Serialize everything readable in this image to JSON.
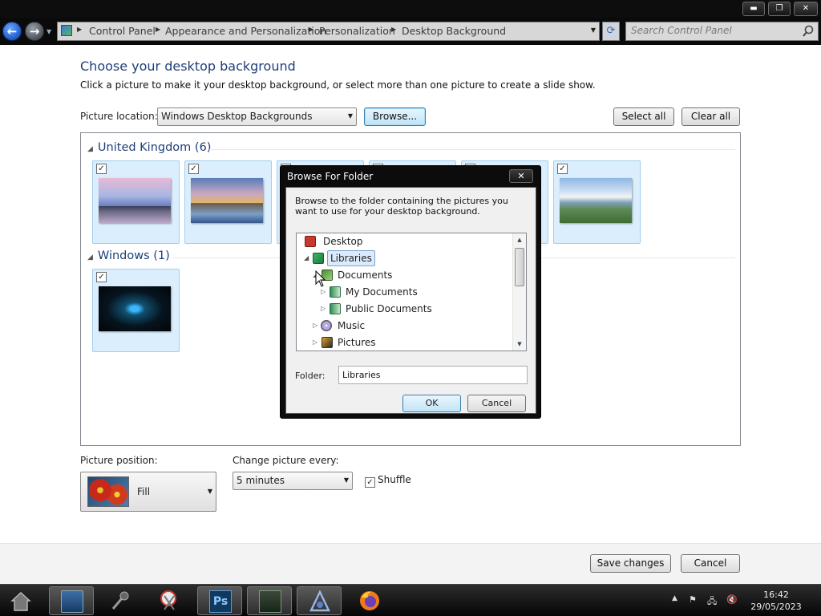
{
  "breadcrumbs": [
    "Control Panel",
    "Appearance and Personalization",
    "Personalization",
    "Desktop Background"
  ],
  "search": {
    "placeholder": "Search Control Panel"
  },
  "page": {
    "title": "Choose your desktop background",
    "subtitle": "Click a picture to make it your desktop background, or select more than one picture to create a slide show."
  },
  "location": {
    "label": "Picture location:",
    "value": "Windows Desktop Backgrounds",
    "browse": "Browse...",
    "select_all": "Select all",
    "clear_all": "Clear all"
  },
  "groups": [
    {
      "title": "United Kingdom (6)"
    },
    {
      "title": "Windows (1)"
    }
  ],
  "dialog": {
    "title": "Browse For Folder",
    "close": "✕",
    "description": "Browse to the folder containing the pictures you want to use for your desktop background.",
    "tree": [
      "Desktop",
      "Libraries",
      "Documents",
      "My Documents",
      "Public Documents",
      "Music",
      "Pictures"
    ],
    "folder_label": "Folder:",
    "folder_value": "Libraries",
    "ok": "OK",
    "cancel": "Cancel"
  },
  "position": {
    "label": "Picture position:",
    "value": "Fill"
  },
  "interval": {
    "label": "Change picture every:",
    "value": "5 minutes"
  },
  "shuffle": {
    "label": "Shuffle",
    "checked": true
  },
  "footer": {
    "save": "Save changes",
    "cancel": "Cancel"
  },
  "clock": {
    "time": "16:42",
    "date": "29/05/2023"
  },
  "window_controls": {
    "minimize": "▬",
    "restore": "❐",
    "close": "✕"
  }
}
